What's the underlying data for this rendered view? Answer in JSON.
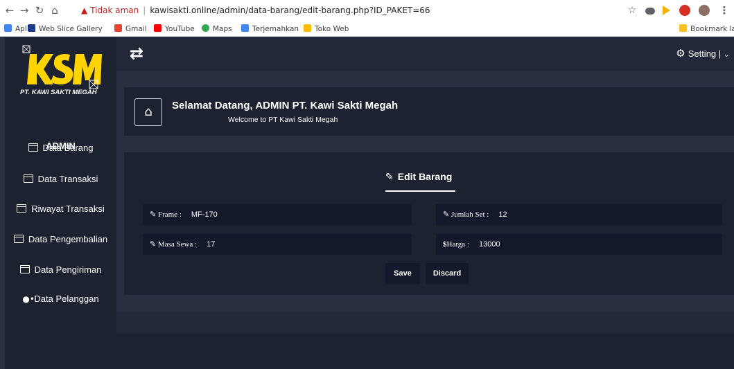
{
  "browser": {
    "security_label": "Tidak aman",
    "url": "kawisakti.online/admin/data-barang/edit-barang.php?ID_PAKET=66",
    "bookmarks": [
      {
        "label": "Apl"
      },
      {
        "label": "Web Slice Gallery"
      },
      {
        "label": "Gmail"
      },
      {
        "label": "YouTube"
      },
      {
        "label": "Maps"
      },
      {
        "label": "Terjemahkan"
      },
      {
        "label": "Toko Web"
      }
    ],
    "bookmark_other": "Bookmark lain"
  },
  "brand": {
    "logo_text": "KSM",
    "logo_subtitle": "PT. KAWI SAKTI MEGAH",
    "logo_color": "#ffd400"
  },
  "sidebar": {
    "title": "ADMIN",
    "items": [
      {
        "label": "Data Barang",
        "icon": "folder-icon"
      },
      {
        "label": "Data Transaksi",
        "icon": "folder-icon"
      },
      {
        "label": "Riwayat Transaksi",
        "icon": "folder-icon"
      },
      {
        "label": "Data Pengembalian",
        "icon": "folder-icon"
      },
      {
        "label": "Data Pengiriman",
        "icon": "folder-icon"
      },
      {
        "label": "Data Pelanggan",
        "icon": "users-icon"
      }
    ]
  },
  "topbar": {
    "setting_label": "Setting |"
  },
  "welcome": {
    "title": "Selamat Datang, ADMIN PT. Kawi Sakti Megah",
    "subtitle": "Welcome to PT Kawi Sakti Megah"
  },
  "form": {
    "title": "Edit Barang",
    "fields": {
      "frame": {
        "label": "Frame :",
        "value": "MF-170"
      },
      "jumlah_set": {
        "label": "Jumlah Set :",
        "value": "12"
      },
      "masa_sewa": {
        "label": "Masa Sewa :",
        "value": "17"
      },
      "harga": {
        "label": "Harga :",
        "value": "13000"
      }
    },
    "save_label": "Save",
    "discard_label": "Discard"
  },
  "colors": {
    "sidebar_bg": "#1d2230",
    "page_bg": "#2a3042",
    "field_bg": "#13182a",
    "accent_yellow": "#ffd400",
    "insecure_red": "#c5221f"
  }
}
